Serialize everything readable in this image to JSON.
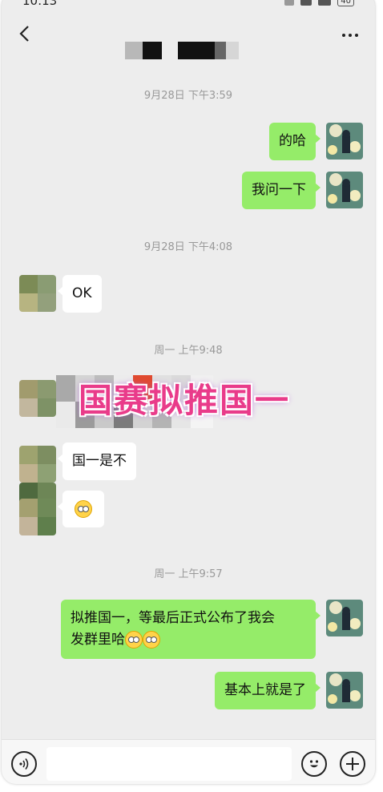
{
  "status_bar": {
    "time": "10:13",
    "battery": "40"
  },
  "nav": {
    "back_icon": "chevron-left-icon",
    "more_icon": "ellipsis-icon"
  },
  "messages": {
    "ts1": "9月28日 下午3:59",
    "m1": "的哈",
    "m2": "我问一下",
    "ts2": "9月28日 下午4:08",
    "m3": "OK",
    "ts3": "周一 上午9:48",
    "overlay": "国赛拟推国一",
    "m5": "国一是不",
    "ts4": "周一 上午9:57",
    "m7_line1": "拟推国一，等最后正式公布了我会",
    "m7_line2": "发群里哈",
    "m8": "基本上就是了"
  },
  "input_bar": {
    "value": "",
    "placeholder": ""
  },
  "colors": {
    "bubble_sent": "#95ec69",
    "bubble_received": "#ffffff",
    "background": "#ededed",
    "overlay_text": "#e93b8a"
  }
}
